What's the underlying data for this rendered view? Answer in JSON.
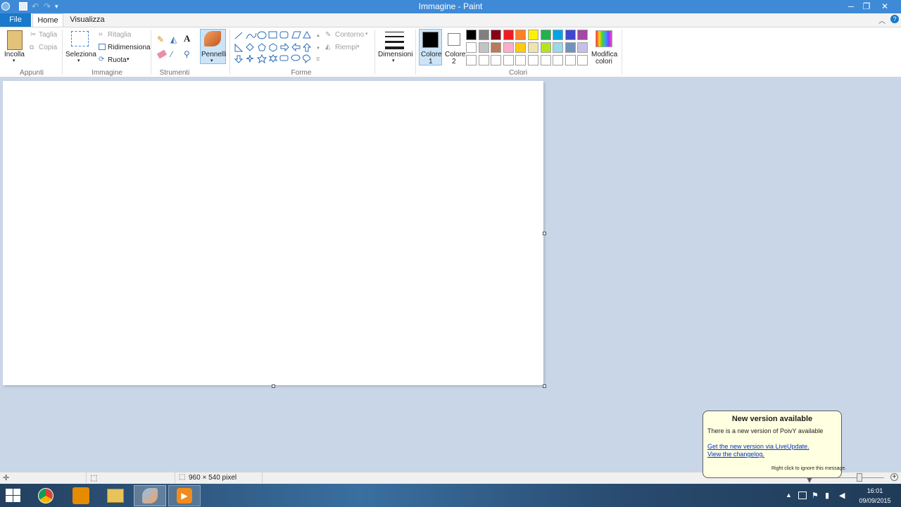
{
  "window": {
    "title": "Immagine - Paint",
    "minimize": "─",
    "restore": "❐",
    "close": "✕"
  },
  "tabs": {
    "file": "File",
    "home": "Home",
    "view": "Visualizza"
  },
  "groups": {
    "clipboard": {
      "label": "Appunti",
      "paste": "Incolla",
      "cut": "Taglia",
      "copy": "Copia"
    },
    "image": {
      "label": "Immagine",
      "select": "Seleziona",
      "crop": "Ritaglia",
      "resize": "Ridimensiona",
      "rotate": "Ruota"
    },
    "tools": {
      "label": "Strumenti",
      "brushes": "Pennelli"
    },
    "shapes": {
      "label": "Forme",
      "outline": "Contorno",
      "fill": "Riempi"
    },
    "size": {
      "label": "Dimensioni"
    },
    "colors": {
      "label": "Colori",
      "color1_a": "Colore",
      "color1_b": "1",
      "color2_a": "Colore",
      "color2_b": "2",
      "edit_a": "Modifica",
      "edit_b": "colori",
      "palette_row1": [
        "#000000",
        "#7f7f7f",
        "#880015",
        "#ed1c24",
        "#ff7f27",
        "#fff200",
        "#22b14c",
        "#00a2e8",
        "#3f48cc",
        "#a349a4"
      ],
      "palette_row2": [
        "#ffffff",
        "#c3c3c3",
        "#b97a57",
        "#ffaec9",
        "#ffc90e",
        "#efe4b0",
        "#b5e61d",
        "#99d9ea",
        "#7092be",
        "#c8bfe7"
      ]
    }
  },
  "status": {
    "dimensions": "960 × 540 pixel"
  },
  "balloon": {
    "title": "New version available",
    "body": "There is a new version of PoivY available",
    "link1": "Get the new version via LiveUpdate.",
    "link2": "View the changelog.",
    "footer": "Right click to ignore this message."
  },
  "taskbar": {
    "time": "16:01",
    "date": "09/09/2015"
  }
}
